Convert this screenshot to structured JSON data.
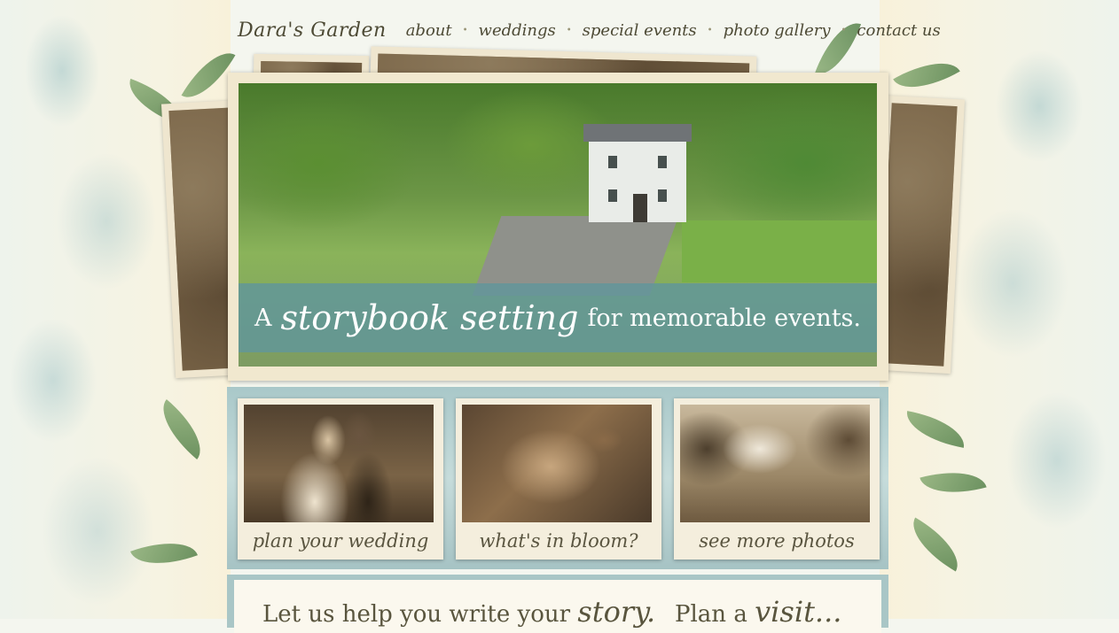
{
  "nav": {
    "logo": "Dara's Garden",
    "items": [
      {
        "label": "about"
      },
      {
        "label": "weddings"
      },
      {
        "label": "special events"
      },
      {
        "label": "photo gallery"
      },
      {
        "label": "contact us"
      }
    ],
    "separator": "•"
  },
  "hero": {
    "lead": "A",
    "script": "storybook setting",
    "tail": "for memorable events."
  },
  "thumbnails": [
    {
      "caption": "plan your wedding"
    },
    {
      "caption": "what's in bloom?"
    },
    {
      "caption": "see more photos"
    }
  ],
  "content": {
    "story_heading_lead": "Let us help you write your",
    "story_heading_script": "story.",
    "visit_heading_lead": "Plan a",
    "visit_heading_script": "visit..."
  },
  "colors": {
    "band": "#60969b",
    "frame": "#f1e8cf",
    "text": "#59553e"
  }
}
